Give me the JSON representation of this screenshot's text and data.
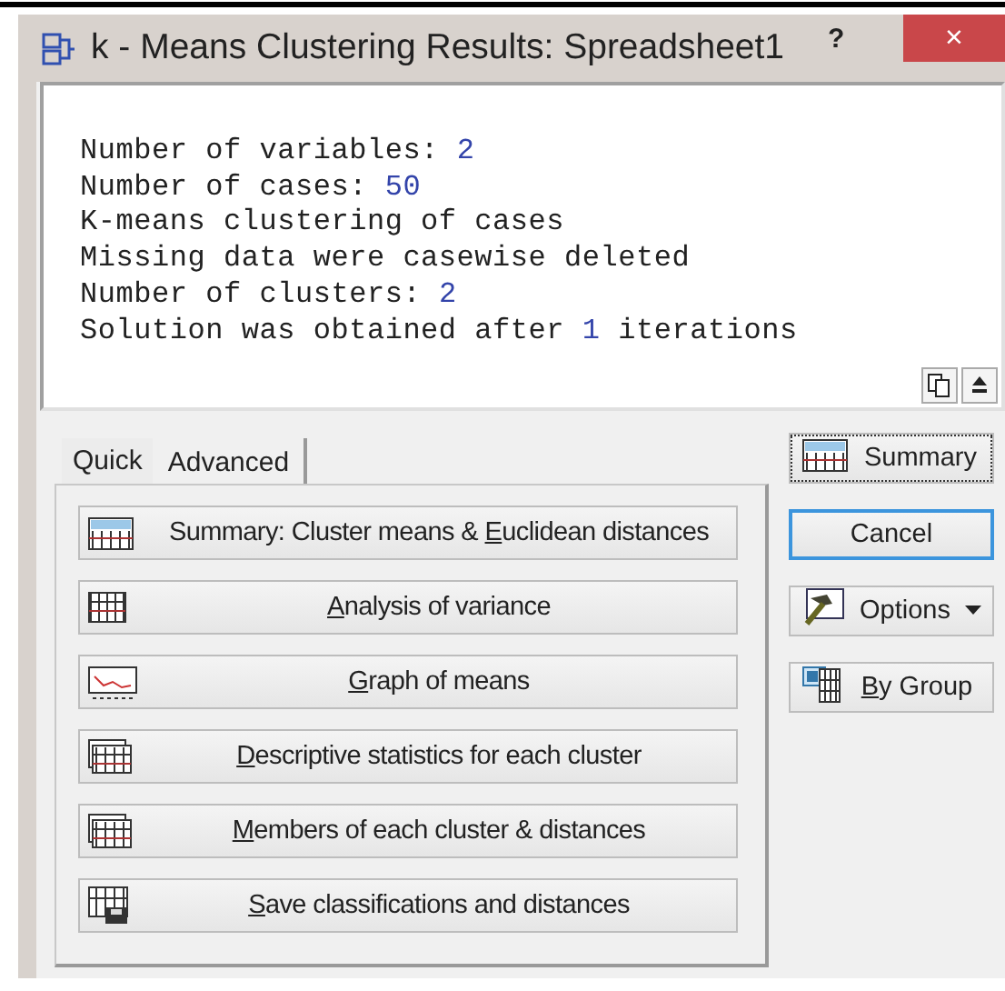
{
  "window": {
    "title": "k - Means Clustering Results: Spreadsheet1",
    "help": "?",
    "close": "×"
  },
  "output": {
    "lines": [
      {
        "text": "Number of variables: ",
        "value": "2"
      },
      {
        "text": "Number of cases: ",
        "value": "50"
      },
      {
        "text": "K-means clustering of cases"
      },
      {
        "text": "Missing data were casewise deleted"
      },
      {
        "text": "Number of clusters: ",
        "value": "2"
      },
      {
        "text": "Solution was obtained after ",
        "value": "1",
        "suffix": " iterations"
      }
    ]
  },
  "tabs": [
    {
      "label": "Quick",
      "selected": false
    },
    {
      "label": "Advanced",
      "selected": true
    }
  ],
  "commands": [
    {
      "prefix": "Summary: Cluster means & ",
      "key": "E",
      "rest": "uclidean distances"
    },
    {
      "key": "A",
      "rest": "nalysis of variance"
    },
    {
      "key": "G",
      "rest": "raph of means"
    },
    {
      "key": "D",
      "rest": "escriptive statistics for each cluster"
    },
    {
      "key": "M",
      "rest": "embers of each cluster & distances"
    },
    {
      "key": "S",
      "rest": "ave classifications and distances"
    }
  ],
  "side_buttons": [
    {
      "kind": "focused",
      "rest": "Summary"
    },
    {
      "kind": "default",
      "rest": "Cancel"
    },
    {
      "kind": "dropdown",
      "rest": "Options"
    },
    {
      "kind": "plain",
      "key": "B",
      "rest": "y Group"
    }
  ]
}
